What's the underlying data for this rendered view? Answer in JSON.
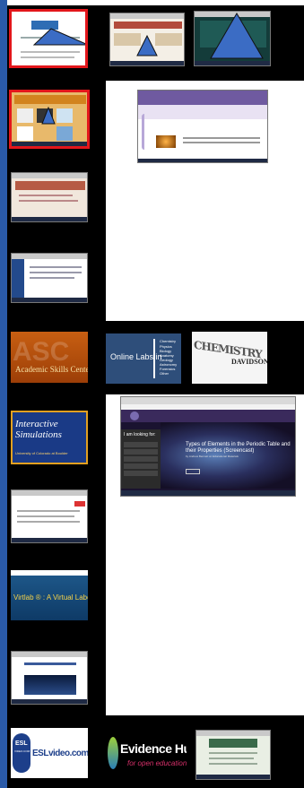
{
  "tiles": {
    "asc": {
      "label": "Academic Skills Center"
    },
    "online_labs": {
      "label": "Online Labs in",
      "subjects": [
        "Chemistry",
        "Physics",
        "Biology",
        "Anatomy",
        "Geology",
        "Astronomy",
        "Forensics",
        "Other"
      ]
    },
    "davidson": {
      "label": "CHEMISTRY",
      "suffix": "DAVIDSON"
    },
    "interactive": {
      "title": "Interactive Simulations",
      "subtitle": "University of Colorado at Boulder"
    },
    "phet_page": {
      "sidebar_heading": "I am looking for:",
      "hero_title": "Types of Elements in the Periodic Table and their Properties (Screencast)",
      "hero_sub": "by Andrew Bennett on Educational Materials"
    },
    "virtlab": {
      "label": "Virtlab ® : A Virtual Laboratory"
    },
    "esl": {
      "badge_top": "ESL",
      "badge_bottom": "VIDEO.COM",
      "label": "ESLvideo.com"
    },
    "evidence": {
      "title": "Evidence Hub",
      "subtitle": "for open education"
    }
  },
  "colors": {
    "frame": "#000000",
    "highlight": "#e3161b",
    "marker": "#3b6cc4",
    "accent": "#2a5aa8"
  }
}
